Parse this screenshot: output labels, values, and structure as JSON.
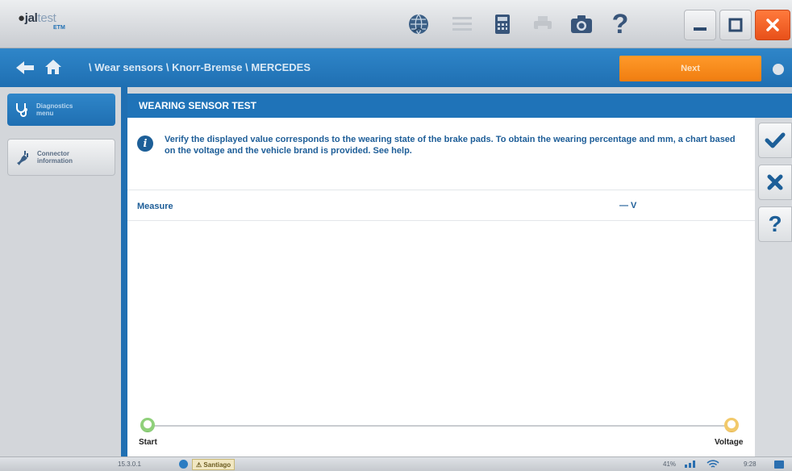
{
  "app": {
    "logo_main": "jal",
    "logo_test": "test",
    "logo_sub": "ETM"
  },
  "toolbar": {
    "icons": [
      "globe-icon",
      "list-icon",
      "calculator-icon",
      "print-icon",
      "camera-icon",
      "help-icon"
    ],
    "help_glyph": "?"
  },
  "window_controls": [
    "minimize-icon",
    "maximize-icon",
    "close-icon"
  ],
  "breadcrumb": {
    "path": "\\ Wear sensors \\ Knorr-Bremse \\ MERCEDES"
  },
  "next_button": {
    "label": "Next"
  },
  "sidebar": {
    "items": [
      {
        "label_line1": "Diagnostics",
        "label_line2": "menu",
        "icon": "stethoscope-icon",
        "active": true
      },
      {
        "label_line1": "Connector",
        "label_line2": "information",
        "icon": "connector-icon",
        "active": false
      }
    ]
  },
  "panel": {
    "title": "WEARING SENSOR TEST",
    "info_text": "Verify the displayed value corresponds to the wearing state of the brake pads.  To obtain the wearing percentage and mm, a chart based on the voltage and the vehicle brand is provided.  See help.",
    "measure_label": "Measure",
    "measure_value": "— V",
    "gauge_start_label": "Start",
    "gauge_end_label": "Voltage"
  },
  "actions": {
    "buttons": [
      "check-icon",
      "close-icon",
      "help-icon"
    ],
    "help_glyph": "?"
  },
  "statusbar": {
    "version": "15.3.0.1",
    "user": "Santiago",
    "battery": "41%",
    "time": "9:28"
  },
  "colors": {
    "brand_blue": "#1f73b8",
    "accent_orange": "#f07d10",
    "text_blue": "#1e5e98"
  }
}
